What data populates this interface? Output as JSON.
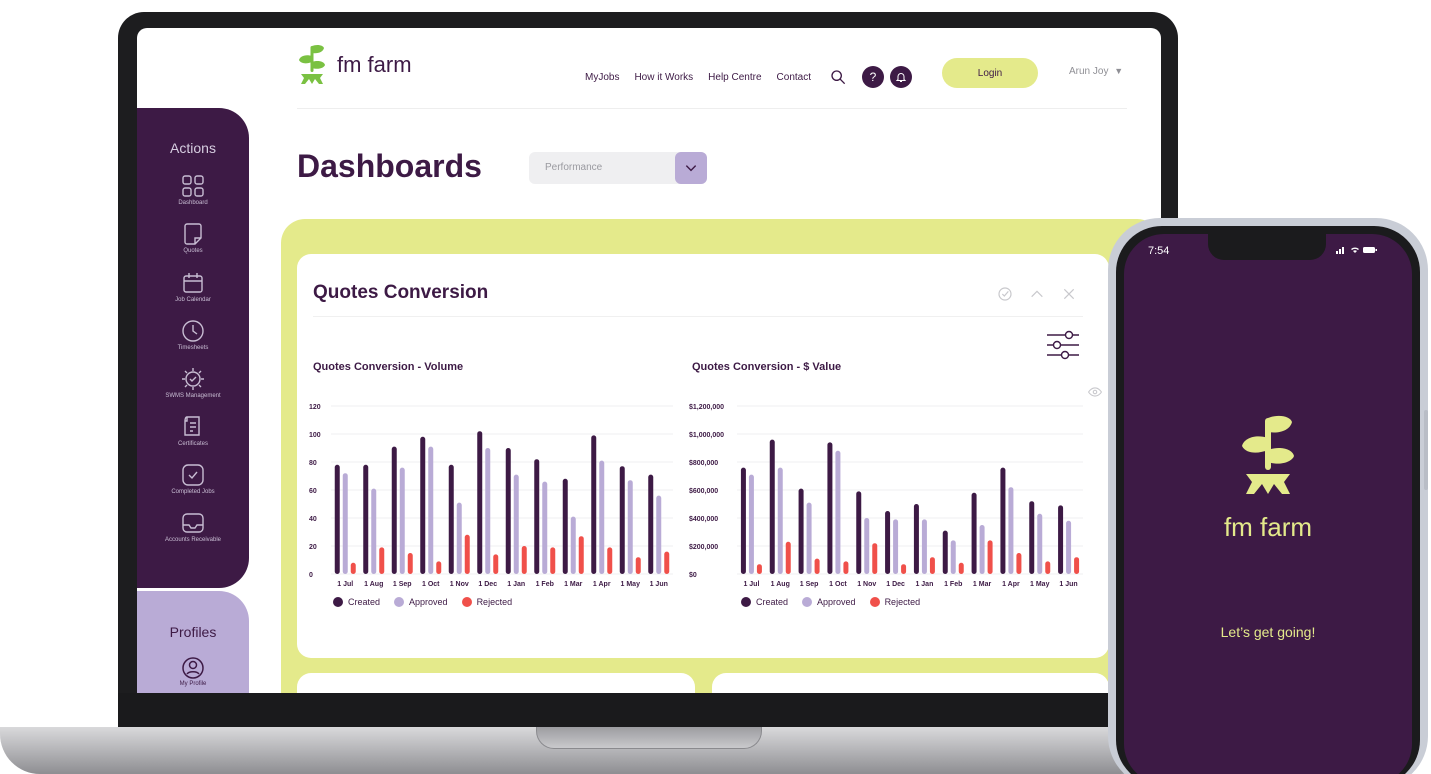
{
  "app": {
    "brand": "fm farm",
    "nav": [
      "MyJobs",
      "How it Works",
      "Help Centre",
      "Contact"
    ],
    "help_symbol": "?",
    "login_label": "Login",
    "user_name": "Arun Joy",
    "colors": {
      "primary": "#3d1a45",
      "accent": "#e4ea8b",
      "lavender": "#b9abd6",
      "red": "#f0504a"
    }
  },
  "sidebar": {
    "actions_title": "Actions",
    "items": [
      {
        "label": "Dashboard",
        "icon": "dashboard-icon"
      },
      {
        "label": "Quotes",
        "icon": "quotes-icon"
      },
      {
        "label": "Job Calendar",
        "icon": "calendar-icon"
      },
      {
        "label": "Timesheets",
        "icon": "clock-icon"
      },
      {
        "label": "SWMS Management",
        "icon": "swms-icon"
      },
      {
        "label": "Certificates",
        "icon": "certificate-icon"
      },
      {
        "label": "Completed Jobs",
        "icon": "check-icon"
      },
      {
        "label": "Accounts Receivable",
        "icon": "inbox-icon"
      }
    ],
    "profiles_title": "Profiles",
    "my_profile_label": "My Profile"
  },
  "main": {
    "page_title": "Dashboards",
    "dropdown_value": "Performance",
    "card_title": "Quotes Conversion"
  },
  "chart_data": [
    {
      "type": "bar",
      "title": "Quotes Conversion - Volume",
      "categories": [
        "1 Jul",
        "1 Aug",
        "1 Sep",
        "1 Oct",
        "1 Nov",
        "1 Dec",
        "1 Jan",
        "1 Feb",
        "1 Mar",
        "1 Apr",
        "1 May",
        "1 Jun"
      ],
      "series": [
        {
          "name": "Created",
          "color": "#3d1a45",
          "values": [
            78,
            78,
            91,
            98,
            78,
            102,
            90,
            82,
            68,
            99,
            77,
            71
          ]
        },
        {
          "name": "Approved",
          "color": "#b9abd6",
          "values": [
            72,
            61,
            76,
            91,
            51,
            90,
            71,
            66,
            41,
            81,
            67,
            56
          ]
        },
        {
          "name": "Rejected",
          "color": "#f0504a",
          "values": [
            8,
            19,
            15,
            9,
            28,
            14,
            20,
            19,
            27,
            19,
            12,
            16
          ]
        }
      ],
      "yticks": [
        "0",
        "20",
        "40",
        "60",
        "80",
        "100",
        "120"
      ],
      "ylim": [
        0,
        120
      ],
      "legend": "bottom-left"
    },
    {
      "type": "bar",
      "title": "Quotes Conversion - $ Value",
      "categories": [
        "1 Jul",
        "1 Aug",
        "1 Sep",
        "1 Oct",
        "1 Nov",
        "1 Dec",
        "1 Jan",
        "1 Feb",
        "1 Mar",
        "1 Apr",
        "1 May",
        "1 Jun"
      ],
      "series": [
        {
          "name": "Created",
          "color": "#3d1a45",
          "values": [
            760000,
            960000,
            610000,
            940000,
            590000,
            450000,
            500000,
            310000,
            580000,
            760000,
            520000,
            490000
          ]
        },
        {
          "name": "Approved",
          "color": "#b9abd6",
          "values": [
            710000,
            760000,
            510000,
            880000,
            400000,
            390000,
            390000,
            240000,
            350000,
            620000,
            430000,
            380000
          ]
        },
        {
          "name": "Rejected",
          "color": "#f0504a",
          "values": [
            70000,
            230000,
            110000,
            90000,
            220000,
            70000,
            120000,
            80000,
            240000,
            150000,
            90000,
            120000
          ]
        }
      ],
      "yticks": [
        "$0",
        "$200,000",
        "$400,000",
        "$600,000",
        "$800,000",
        "$1,000,000",
        "$1,200,000"
      ],
      "ylim": [
        0,
        1200000
      ],
      "legend": "bottom-left"
    }
  ],
  "phone": {
    "time": "7:54",
    "brand": "fm farm",
    "tagline": "Let’s get going!"
  }
}
